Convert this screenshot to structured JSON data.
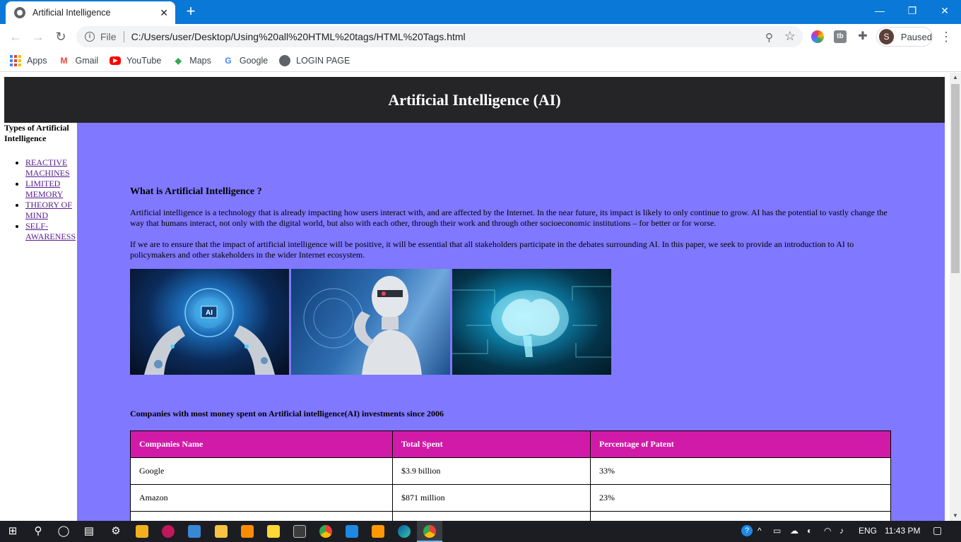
{
  "browser": {
    "tab_title": "Artificial Intelligence",
    "new_tab": "+",
    "scheme_label": "File",
    "url": "C:/Users/user/Desktop/Using%20all%20HTML%20tags/HTML%20Tags.html",
    "profile_initial": "S",
    "profile_status": "Paused"
  },
  "bookmarks": [
    {
      "label": "Apps",
      "icon": "apps-grid-icon"
    },
    {
      "label": "Gmail",
      "icon": "gmail-icon"
    },
    {
      "label": "YouTube",
      "icon": "youtube-icon"
    },
    {
      "label": "Maps",
      "icon": "maps-icon"
    },
    {
      "label": "Google",
      "icon": "google-icon"
    },
    {
      "label": "LOGIN PAGE",
      "icon": "globe-icon"
    }
  ],
  "page": {
    "header": "Artificial Intelligence (AI)",
    "sidebar": {
      "heading": "Types of Artificial Intelligence",
      "links": [
        "REACTIVE MACHINES",
        "LIMITED MEMORY",
        "THEORY OF MIND",
        "SELF-AWARENESS"
      ]
    },
    "section_title": "What is Artificial Intelligence ?",
    "paragraph1": "Artificial intelligence is a technology that is already impacting how users interact with, and are affected by the Internet. In the near future, its impact is likely to only continue to grow. AI has the potential to vastly change the way that humans interact, not only with the digital world, but also with each other, through their work and through other socioeconomic institutions – for better or for worse.",
    "paragraph2": "If we are to ensure that the impact of artificial intelligence will be positive, it will be essential that all stakeholders participate in the debates surrounding AI. In this paper, we seek to provide an introduction to AI to policymakers and other stakeholders in the wider Internet ecosystem.",
    "images": [
      {
        "name": "ai-robot-hands-image",
        "label": "AI"
      },
      {
        "name": "humanoid-robot-image",
        "label": ""
      },
      {
        "name": "circuit-brain-image",
        "label": ""
      }
    ],
    "table_caption": "Companies with most money spent on Artificial intelligence(AI) investments since 2006",
    "table": {
      "headers": [
        "Companies Name",
        "Total Spent",
        "Percentage of Patent"
      ],
      "rows": [
        [
          "Google",
          "$3.9 billion",
          "33%"
        ],
        [
          "Amazon",
          "$871 million",
          "23%"
        ]
      ]
    }
  },
  "taskbar": {
    "lang": "ENG",
    "time": "11:43 PM"
  },
  "colors": {
    "chrome_blue": "#0a78d7",
    "page_header_bg": "#252427",
    "main_bg": "#8078ff",
    "table_header_bg": "#d21aa8"
  }
}
